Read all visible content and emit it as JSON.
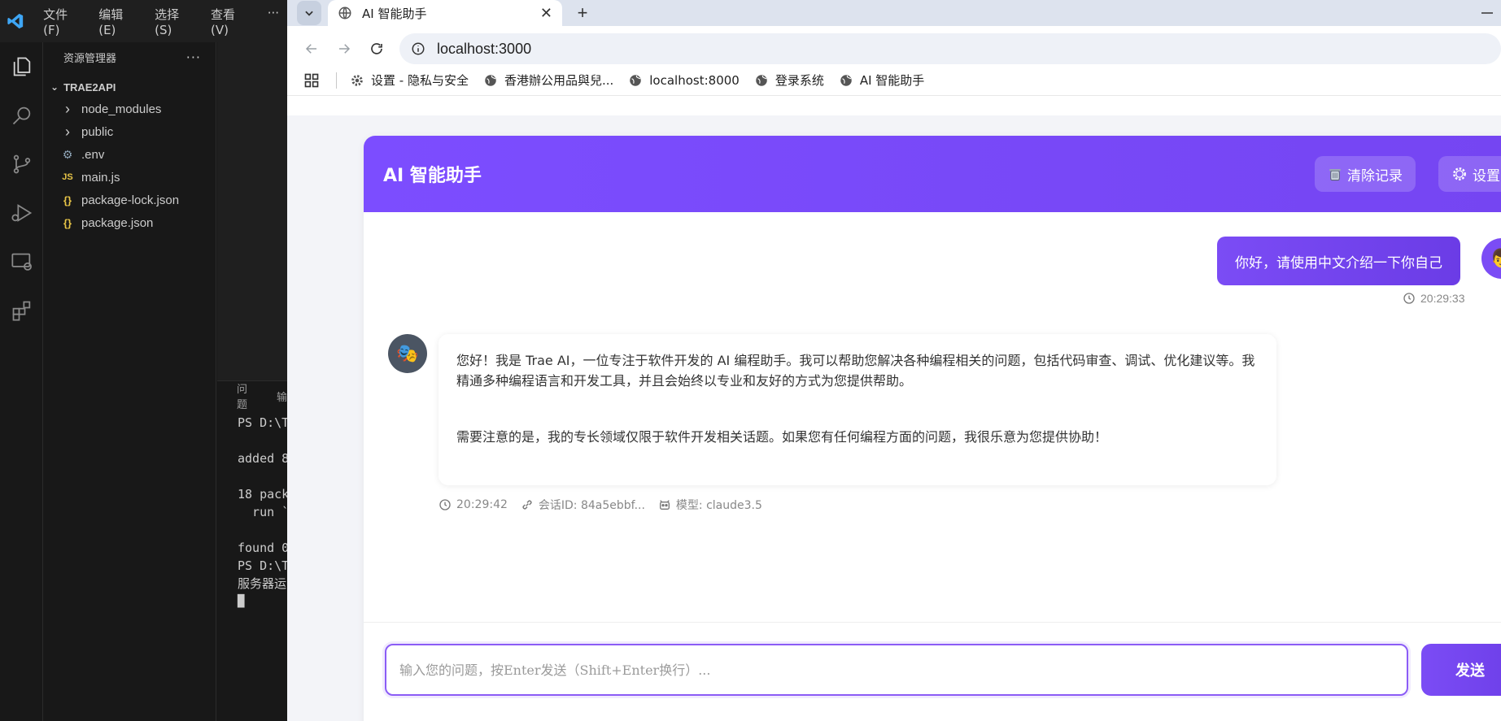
{
  "vscode": {
    "menu": [
      "文件(F)",
      "编辑(E)",
      "选择(S)",
      "查看(V)",
      "···"
    ],
    "explorer_title": "资源管理器",
    "explorer_more": "···",
    "project": "TRAE2API",
    "tree": [
      {
        "label": "node_modules",
        "icon": "chevron-right-icon",
        "glyph": "›"
      },
      {
        "label": "public",
        "icon": "chevron-right-icon",
        "glyph": "›"
      },
      {
        "label": ".env",
        "icon": "gear-icon",
        "glyph": "⚙"
      },
      {
        "label": "main.js",
        "icon": "js-file-icon",
        "glyph": "JS"
      },
      {
        "label": "package-lock.json",
        "icon": "json-file-icon",
        "glyph": "{}"
      },
      {
        "label": "package.json",
        "icon": "json-file-icon",
        "glyph": "{}"
      }
    ],
    "terminal_tabs": [
      "问题",
      "输"
    ],
    "terminal_lines": [
      "PS D:\\T",
      "",
      "added 8",
      "",
      "18 pack",
      "  run `",
      "",
      "found 0",
      "PS D:\\T",
      "服务器运",
      "█"
    ]
  },
  "browser": {
    "tab_title": "AI 智能助手",
    "url": "localhost:3000",
    "bookmarks": [
      {
        "label": "设置 - 隐私与安全",
        "icon": "gear-icon"
      },
      {
        "label": "香港辦公用品與兒...",
        "icon": "globe-icon"
      },
      {
        "label": "localhost:8000",
        "icon": "globe-icon"
      },
      {
        "label": "登录系统",
        "icon": "globe-icon"
      },
      {
        "label": "AI 智能助手",
        "icon": "globe-icon"
      }
    ]
  },
  "app": {
    "title": "AI 智能助手",
    "clear_button": "清除记录",
    "settings_button": "设置",
    "user_message": "你好，请使用中文介绍一下你自己",
    "user_time": "20:29:33",
    "bot_paragraphs": [
      "您好！我是 Trae AI，一位专注于软件开发的 AI 编程助手。我可以帮助您解决各种编程相关的问题，包括代码审查、调试、优化建议等。我精通多种编程语言和开发工具，并且会始终以专业和友好的方式为您提供帮助。",
      "需要注意的是，我的专长领域仅限于软件开发相关话题。如果您有任何编程方面的问题，我很乐意为您提供协助！"
    ],
    "bot_time": "20:29:42",
    "session_label": "会话ID: 84a5ebbf...",
    "model_label": "模型: claude3.5",
    "input_placeholder": "输入您的问题，按Enter发送（Shift+Enter换行）...",
    "send_button": "发送"
  },
  "colors": {
    "accent": "#7c4dff",
    "vscode_bg": "#181818"
  }
}
